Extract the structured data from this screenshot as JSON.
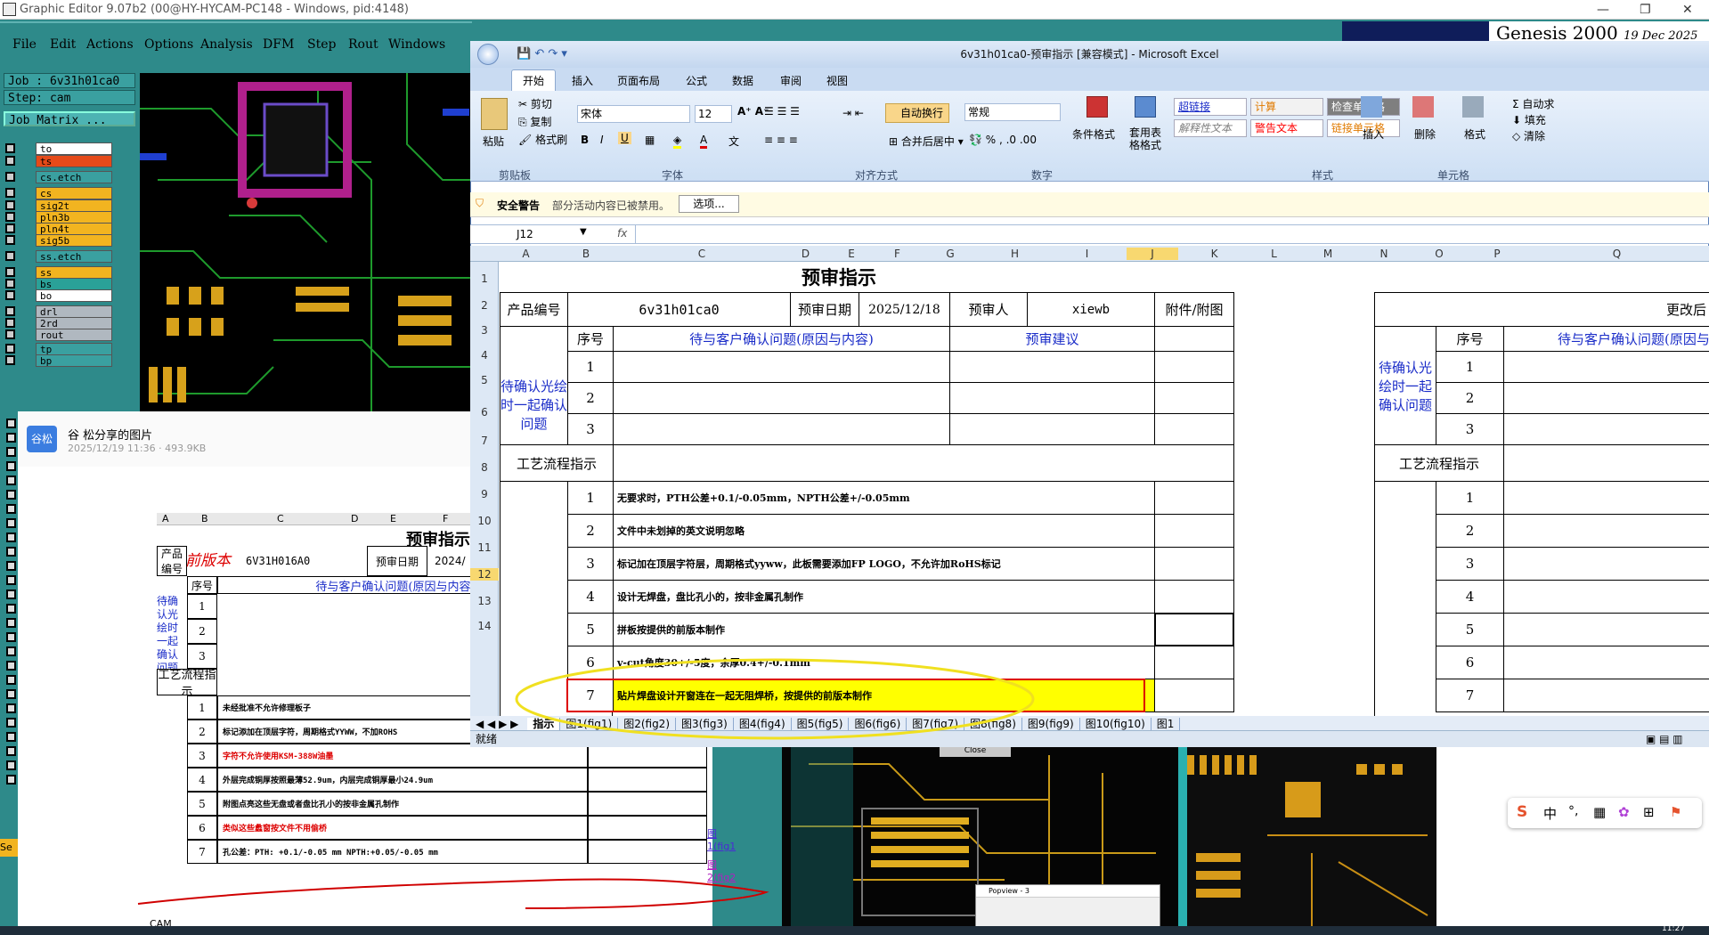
{
  "genesis": {
    "title": "Graphic Editor 9.07b2 (00@HY-HYCAM-PC148 - Windows, pid:4148)",
    "menu": [
      "File",
      "Edit",
      "Actions",
      "Options",
      "Analysis",
      "DFM",
      "Step",
      "Rout",
      "Windows"
    ],
    "brand": "Genesis 2000",
    "brand_date": "19 Dec 2025",
    "job_label": "Job : 6v31h01ca0",
    "step_label": "Step: cam",
    "job_matrix": "Job Matrix ...",
    "layers": [
      {
        "name": "to",
        "color": "#ffffff"
      },
      {
        "name": "ts",
        "color": "#e64a19"
      },
      {
        "name": "cs.etch",
        "color": "#3aa0a0"
      },
      {
        "name": "cs",
        "color": "#f2b420"
      },
      {
        "name": "sig2t",
        "color": "#f2b420"
      },
      {
        "name": "pln3b",
        "color": "#f2b420"
      },
      {
        "name": "pln4t",
        "color": "#f2b420"
      },
      {
        "name": "sig5b",
        "color": "#f2b420"
      },
      {
        "name": "ss.etch",
        "color": "#3aa0a0"
      },
      {
        "name": "ss",
        "color": "#f2b420"
      },
      {
        "name": "bs",
        "color": "#2aa198"
      },
      {
        "name": "bo",
        "color": "#ffffff"
      },
      {
        "name": "drl",
        "color": "#b0b8c0"
      },
      {
        "name": "2rd",
        "color": "#b0b8c0"
      },
      {
        "name": "rout",
        "color": "#b0b8c0"
      },
      {
        "name": "tp",
        "color": "#3aa0a0"
      },
      {
        "name": "bp",
        "color": "#3aa0a0"
      }
    ]
  },
  "viewer": {
    "uploader_icon": "谷松",
    "title": "谷  松分享的图片",
    "meta": "2025/12/19 11:36 · 493.9KB",
    "doc": {
      "title": "预审指示",
      "product_label": "产品编号",
      "handwritten": "前版本",
      "product_no": "6V31H016A0",
      "date_label": "预审日期",
      "date_val": "2024/",
      "seq_label": "序号",
      "confirm_header": "待与客户确认问题(原因与内容)",
      "left_label": "待确认光绘时一起确认问题",
      "process_label": "工艺流程指示",
      "rows": [
        {
          "n": "1",
          "t": "未经批准不允许修理板子",
          "red": false
        },
        {
          "n": "2",
          "t": "标记添加在顶层字符，周期格式YYWW，不加ROHS",
          "red": false
        },
        {
          "n": "3",
          "t": "字符不允许使用KSM-388W油墨",
          "red": true
        },
        {
          "n": "4",
          "t": "外层完成铜厚按照最薄52.9um，内层完成铜厚最小24.9um",
          "red": false
        },
        {
          "n": "5",
          "t": "附图点亮这些无盘或者盘比孔小的按非金属孔制作",
          "red": false
        },
        {
          "n": "6",
          "t": "类似这些蠡窗按文件不用偷桥",
          "red": true
        },
        {
          "n": "7",
          "t": "孔公差：PTH:  +0.1/-0.05 mm        NPTH:+0.05/-0.05 mm",
          "red": false
        }
      ],
      "links": [
        "图1(fig1",
        "图2(fig2"
      ],
      "cols": [
        "A",
        "B",
        "C",
        "D",
        "E",
        "F"
      ],
      "cam_label": "CAM"
    }
  },
  "excel": {
    "title": "6v31h01ca0-预审指示  [兼容模式] - Microsoft Excel",
    "tabs": [
      "开始",
      "插入",
      "页面布局",
      "公式",
      "数据",
      "审阅",
      "视图"
    ],
    "ribbon": {
      "paste": "粘贴",
      "cut": "剪切",
      "copy": "复制",
      "format_painter": "格式刷",
      "font_name": "宋体",
      "font_size": "12",
      "wrap": "自动换行",
      "merge": "合并后居中",
      "number_format": "常规",
      "cond_format": "条件格式",
      "table_format": "套用表格格式",
      "styles": [
        {
          "label": "超链接",
          "color": "#1a2cc8",
          "bg": "#ffffff"
        },
        {
          "label": "计算",
          "color": "#e07a00",
          "bg": "#f2f2f2"
        },
        {
          "label": "检查单元格",
          "color": "#ffffff",
          "bg": "#7f7f7f"
        },
        {
          "label": "解释性文本",
          "color": "#7f7f7f",
          "bg": "#ffffff"
        },
        {
          "label": "警告文本",
          "color": "#ff0000",
          "bg": "#ffffff"
        },
        {
          "label": "链接单元格",
          "color": "#e07a00",
          "bg": "#ffffff"
        }
      ],
      "insert": "插入",
      "delete": "删除",
      "format": "格式",
      "autosum": "自动求",
      "fill": "填充",
      "clear": "清除",
      "groups": [
        "剪贴板",
        "字体",
        "对齐方式",
        "数字",
        "样式",
        "单元格"
      ]
    },
    "security": {
      "label": "安全警告",
      "text": "部分活动内容已被禁用。",
      "button": "选项..."
    },
    "name_box": "J12",
    "fx": "fx",
    "columns": [
      "A",
      "B",
      "C",
      "D",
      "E",
      "F",
      "G",
      "H",
      "I",
      "J",
      "K",
      "L",
      "M",
      "N",
      "O",
      "P",
      "Q"
    ],
    "row_numbers": [
      "1",
      "2",
      "3",
      "4",
      "5",
      "6",
      "7",
      "8",
      "9",
      "10",
      "11",
      "12",
      "13",
      "14"
    ],
    "sheet": {
      "title": "预审指示",
      "product_label": "产品编号",
      "product_no": "6v31h01ca0",
      "date_label": "预审日期",
      "date_val": "2025/12/18",
      "reviewer_label": "预审人",
      "reviewer": "xiewb",
      "attach_label": "附件/附图",
      "seq_label": "序号",
      "confirm_header": "待与客户确认问题(原因与内容)",
      "suggest_header": "预审建议",
      "left_label": "待确认光绘时一起确认问题",
      "process_label": "工艺流程指示",
      "confirm_rows": [
        "1",
        "2",
        "3"
      ],
      "process_rows": [
        {
          "n": "1",
          "t": "无要求时，PTH公差+0.1/-0.05mm，NPTH公差+/-0.05mm"
        },
        {
          "n": "2",
          "t": "文件中未划掉的英文说明忽略"
        },
        {
          "n": "3",
          "t": "标记加在顶层字符层，周期格式yyww，此板需要添加FP LOGO，不允许加RoHS标记"
        },
        {
          "n": "4",
          "t": "设计无焊盘，盘比孔小的，按非金属孔制作"
        },
        {
          "n": "5",
          "t": "拼板按提供的前版本制作"
        },
        {
          "n": "6",
          "t": "v-cut角度30+/-5度，余厚0.4+/-0.1mm"
        },
        {
          "n": "7",
          "t": "贴片焊盘设计开窗连在一起无阻焊桥，按提供的前版本制作"
        }
      ],
      "right_title": "更改后",
      "right_left_label": "待确认光绘时一起确认问题",
      "right_process_label": "工艺流程指示",
      "right_header": "待与客户确认问题(原因与"
    },
    "sheet_tabs": [
      "指示",
      "图1(fig1)",
      "图2(fig2)",
      "图3(fig3)",
      "图4(fig4)",
      "图5(fig5)",
      "图6(fig6)",
      "图7(fig7)",
      "图8(fig8)",
      "图9(fig9)",
      "图10(fig10)",
      "图1"
    ],
    "status": "就绪"
  },
  "popup": {
    "title": "Popview - 3",
    "close": "Close"
  },
  "ime": {
    "items": [
      "S",
      "中",
      "°,",
      "▦",
      "✿",
      "⊞",
      "⚑"
    ]
  },
  "clock": "11:27",
  "colors": {
    "genesis_bg": "#2e8a8a",
    "excel_blue": "#1a2cc8",
    "highlight": "#ffff00",
    "annot_red": "#d00000",
    "annot_yellow": "#f0e020"
  }
}
